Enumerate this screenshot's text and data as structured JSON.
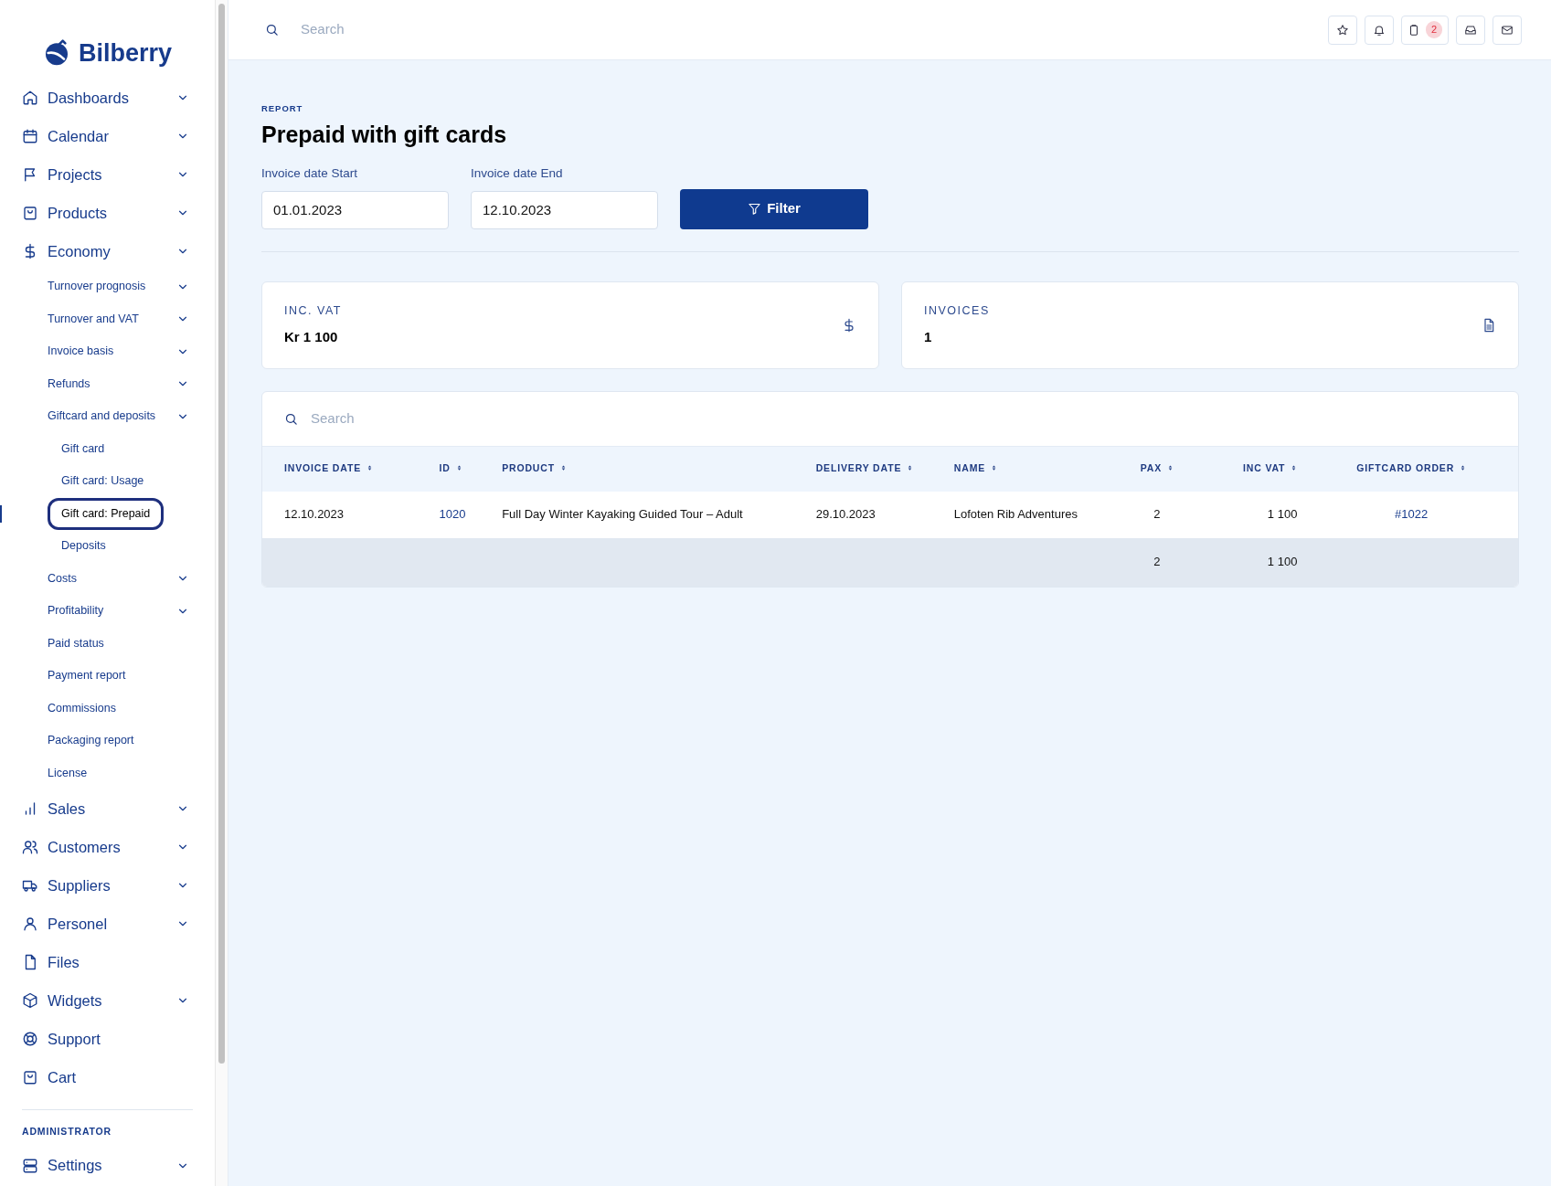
{
  "sidebar": {
    "logo": "Bilberry",
    "items": [
      {
        "label": "Dashboards",
        "chevron": true,
        "selected": false
      },
      {
        "label": "Calendar",
        "chevron": true,
        "selected": false
      },
      {
        "label": "Projects",
        "chevron": true,
        "selected": false
      },
      {
        "label": "Products",
        "chevron": true,
        "selected": false
      },
      {
        "label": "Economy",
        "chevron": true,
        "selected": false,
        "children": [
          {
            "label": "Turnover prognosis",
            "chevron": true,
            "selected": false
          },
          {
            "label": "Turnover and VAT",
            "chevron": true,
            "selected": false
          },
          {
            "label": "Invoice basis",
            "chevron": true,
            "selected": false
          },
          {
            "label": "Refunds",
            "chevron": true,
            "selected": false
          },
          {
            "label": "Giftcard and deposits",
            "chevron": true,
            "selected": false,
            "children": [
              {
                "label": "Gift card",
                "chevron": false,
                "selected": false
              },
              {
                "label": "Gift card: Usage",
                "chevron": false,
                "selected": false
              },
              {
                "label": "Gift card: Prepaid",
                "chevron": false,
                "selected": true
              },
              {
                "label": "Deposits",
                "chevron": false,
                "selected": false
              }
            ]
          },
          {
            "label": "Costs",
            "chevron": true,
            "selected": false
          },
          {
            "label": "Profitability",
            "chevron": true,
            "selected": false
          },
          {
            "label": "Paid status",
            "chevron": false,
            "selected": false
          },
          {
            "label": "Payment report",
            "chevron": false,
            "selected": false
          },
          {
            "label": "Commissions",
            "chevron": false,
            "selected": false
          },
          {
            "label": "Packaging report",
            "chevron": false,
            "selected": false
          },
          {
            "label": "License",
            "chevron": false,
            "selected": false
          }
        ]
      },
      {
        "label": "Sales",
        "chevron": true,
        "selected": false
      },
      {
        "label": "Customers",
        "chevron": true,
        "selected": false
      },
      {
        "label": "Suppliers",
        "chevron": true,
        "selected": false
      },
      {
        "label": "Personel",
        "chevron": true,
        "selected": false
      },
      {
        "label": "Files",
        "chevron": false,
        "selected": false
      },
      {
        "label": "Widgets",
        "chevron": true,
        "selected": false
      },
      {
        "label": "Support",
        "chevron": false,
        "selected": false
      },
      {
        "label": "Cart",
        "chevron": false,
        "selected": false
      }
    ],
    "section": "ADMINISTRATOR",
    "admin_items": [
      {
        "label": "Settings",
        "chevron": true,
        "selected": false
      }
    ]
  },
  "topbar": {
    "search": {
      "placeholder": "Search"
    },
    "buttons": [
      {
        "kind": "star"
      },
      {
        "kind": "bell"
      },
      {
        "kind": "clipboard",
        "badge": "2"
      },
      {
        "kind": "inbox"
      },
      {
        "kind": "mail"
      }
    ]
  },
  "page": {
    "eyebrow": "REPORT",
    "title": "Prepaid with gift cards",
    "filters": [
      {
        "label": "Invoice date Start",
        "value": "01.01.2023"
      },
      {
        "label": "Invoice date End",
        "value": "12.10.2023"
      }
    ],
    "filter_button": "Filter",
    "stats": [
      {
        "kind": "currency",
        "label": "INC. VAT",
        "value": "Kr 1 100"
      },
      {
        "kind": "document",
        "label": "INVOICES",
        "value": "1"
      }
    ]
  },
  "table": {
    "search": {
      "placeholder": "Search"
    },
    "columns": [
      {
        "label": "INVOICE DATE",
        "kind": "text"
      },
      {
        "label": "ID",
        "kind": "link"
      },
      {
        "label": "PRODUCT",
        "kind": "text"
      },
      {
        "label": "DELIVERY DATE",
        "kind": "text"
      },
      {
        "label": "NAME",
        "kind": "text"
      },
      {
        "label": "PAX",
        "kind": "count"
      },
      {
        "label": "INC VAT",
        "kind": "amount"
      },
      {
        "label": "GIFTCARD ORDER",
        "kind": "reference"
      }
    ],
    "rows": [
      [
        "12.10.2023",
        "1020",
        "Full Day Winter Kayaking Guided Tour – Adult",
        "29.10.2023",
        "Lofoten Rib Adventures",
        "2",
        "1 100",
        "#1022"
      ]
    ],
    "totals": {
      "pax": "2",
      "inc_vat": "1 100"
    }
  }
}
